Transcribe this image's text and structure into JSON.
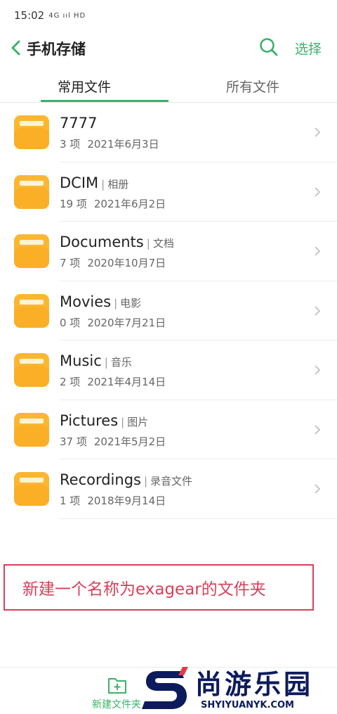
{
  "status_bar": {
    "time": "15:02",
    "signal_text": "4G ııl HD"
  },
  "header": {
    "title": "手机存储",
    "select_label": "选择"
  },
  "tabs": [
    {
      "label": "常用文件",
      "active": true
    },
    {
      "label": "所有文件",
      "active": false
    }
  ],
  "folders": [
    {
      "name": "7777",
      "alias": "",
      "count": "3 项",
      "date": "2021年6月3日"
    },
    {
      "name": "DCIM",
      "alias": "相册",
      "count": "19 项",
      "date": "2021年6月2日"
    },
    {
      "name": "Documents",
      "alias": "文档",
      "count": "7 项",
      "date": "2020年10月7日"
    },
    {
      "name": "Movies",
      "alias": "电影",
      "count": "0 项",
      "date": "2020年7月21日"
    },
    {
      "name": "Music",
      "alias": "音乐",
      "count": "2 项",
      "date": "2021年4月14日"
    },
    {
      "name": "Pictures",
      "alias": "图片",
      "count": "37 项",
      "date": "2021年5月2日"
    },
    {
      "name": "Recordings",
      "alias": "录音文件",
      "count": "1 项",
      "date": "2018年9月14日"
    }
  ],
  "annotation": {
    "text": "新建一个名称为exagear的文件夹"
  },
  "bottom_bar": {
    "new_folder_label": "新建文件夹"
  },
  "watermark": {
    "title": "尚游乐园",
    "url": "SHYIYUANYK.COM"
  },
  "colors": {
    "accent": "#3bb26a",
    "folder": "#fbb731",
    "annotation": "#d9405a",
    "watermark": "#0c1b5c"
  }
}
